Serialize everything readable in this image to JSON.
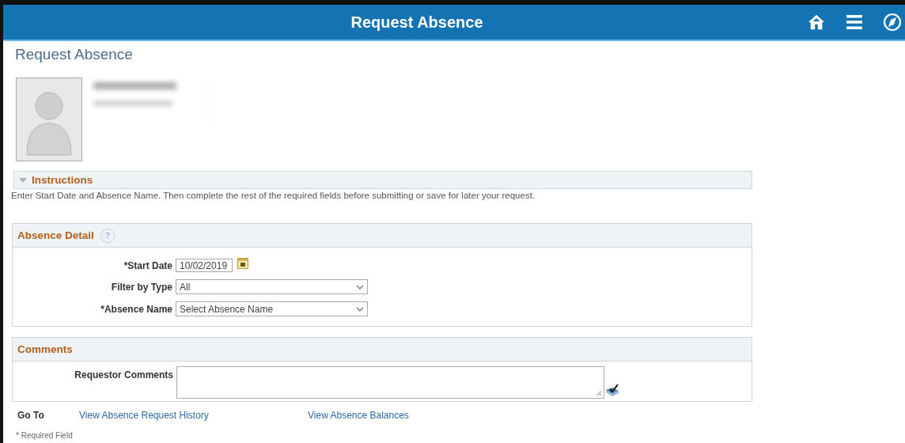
{
  "header": {
    "title": "Request Absence"
  },
  "page_title": "Request Absence",
  "instructions": {
    "title": "Instructions",
    "expanded": true,
    "text": "Enter Start Date and Absence Name. Then complete the rest of the required fields before submitting or save for later your request."
  },
  "absence_detail": {
    "title": "Absence Detail",
    "help": "?",
    "fields": [
      {
        "kind": "date",
        "label": "*Start Date",
        "value": "10/02/2019"
      },
      {
        "kind": "select",
        "label": "Filter by Type",
        "value": "All"
      },
      {
        "kind": "select",
        "label": "*Absence Name",
        "value": "Select Absence Name"
      }
    ]
  },
  "comments": {
    "title": "Comments",
    "fields": [
      {
        "kind": "textarea",
        "label": "Requestor Comments"
      }
    ]
  },
  "goto": {
    "label": "Go To",
    "links": [
      "View Absence Request History",
      "View Absence Balances"
    ]
  },
  "footnote": "* Required Field"
}
